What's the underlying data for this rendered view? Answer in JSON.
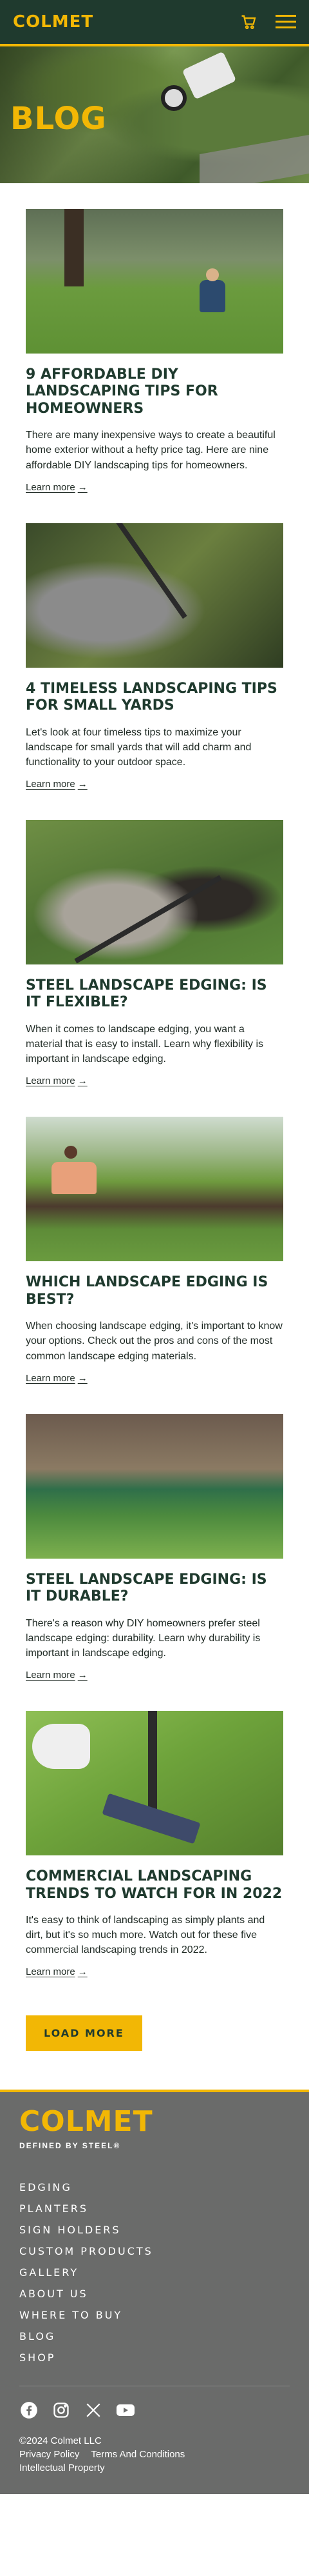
{
  "header": {
    "logo_text": "COLMET",
    "cart_icon": "cart-icon",
    "menu_icon": "hamburger-menu-icon",
    "brand_color": "#f2b705",
    "bg_color": "#1f3a2e"
  },
  "hero": {
    "title": "BLOG"
  },
  "posts": [
    {
      "title": "9 Affordable DIY Landscaping Tips for Homeowners",
      "excerpt": "There are many inexpensive ways to create a beautiful home exterior without a hefty price tag. Here are nine affordable DIY landscaping tips for homeowners.",
      "link_label": "Learn more"
    },
    {
      "title": "4 Timeless Landscaping Tips for Small Yards",
      "excerpt": "Let's look at four timeless tips to maximize your landscape for small yards that will add charm and functionality to your outdoor space.",
      "link_label": "Learn more"
    },
    {
      "title": "Steel Landscape Edging: Is It Flexible?",
      "excerpt": "When it comes to landscape edging, you want a material that is easy to install. Learn why flexibility is important in landscape edging.",
      "link_label": "Learn more"
    },
    {
      "title": "Which Landscape Edging is Best?",
      "excerpt": "When choosing landscape edging, it's important to know your options. Check out the pros and cons of the most common landscape edging materials.",
      "link_label": "Learn more"
    },
    {
      "title": "Steel Landscape Edging: Is It Durable?",
      "excerpt": "There's a reason why DIY homeowners prefer steel landscape edging: durability. Learn why durability is important in landscape edging.",
      "link_label": "Learn more"
    },
    {
      "title": "Commercial Landscaping Trends to Watch for in 2022",
      "excerpt": "It's easy to think of landscaping as simply plants and dirt, but it's so much more. Watch out for these five commercial landscaping trends in 2022.",
      "link_label": "Learn more"
    }
  ],
  "load_more_label": "LOAD MORE",
  "footer": {
    "logo_text": "COLMET",
    "tagline": "DEFINED BY STEEL®",
    "nav": [
      "Edging",
      "Planters",
      "Sign Holders",
      "Custom Products",
      "Gallery",
      "About Us",
      "Where To Buy",
      "Blog",
      "Shop"
    ],
    "social_icons": [
      "facebook-icon",
      "instagram-icon",
      "x-icon",
      "youtube-icon"
    ],
    "copyright": "©2024 Colmet LLC",
    "privacy": "Privacy Policy",
    "terms": "Terms And Conditions",
    "ip": "Intellectual Property"
  }
}
